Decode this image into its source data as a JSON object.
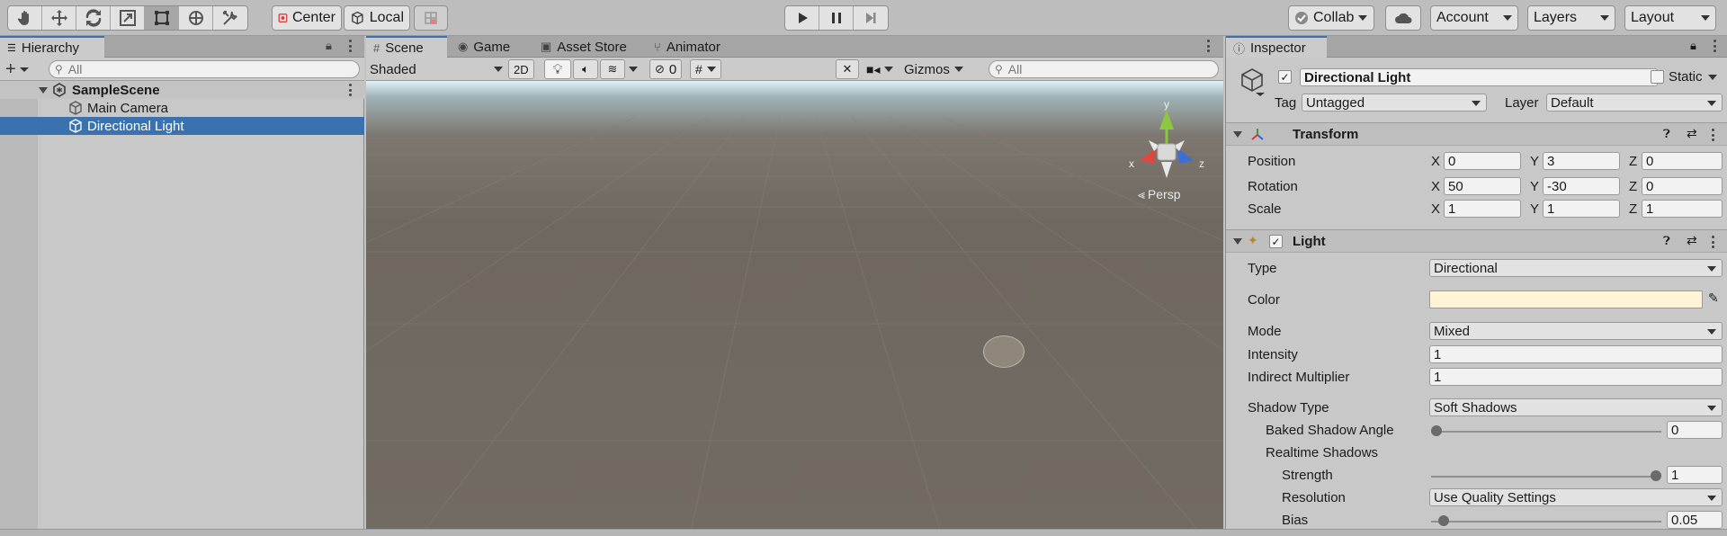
{
  "toolbar": {
    "tools": [
      "hand-tool",
      "move-tool",
      "rotate-tool",
      "scale-tool",
      "rect-tool",
      "transform-tool",
      "custom-tool"
    ],
    "pivot_label": "Center",
    "space_label": "Local",
    "collab_label": "Collab",
    "account_label": "Account",
    "layers_label": "Layers",
    "layout_label": "Layout"
  },
  "hierarchy": {
    "tab_label": "Hierarchy",
    "search_placeholder": "All",
    "scene_name": "SampleScene",
    "items": [
      {
        "label": "Main Camera",
        "selected": false
      },
      {
        "label": "Directional Light",
        "selected": true
      }
    ]
  },
  "scene_tabs": [
    {
      "label": "Scene",
      "icon": "grid-icon",
      "active": true
    },
    {
      "label": "Game",
      "icon": "gamepad-icon",
      "active": false
    },
    {
      "label": "Asset Store",
      "icon": "bag-icon",
      "active": false
    },
    {
      "label": "Animator",
      "icon": "animator-icon",
      "active": false
    }
  ],
  "scene_toolbar": {
    "shading_mode": "Shaded",
    "mode_2d": "2D",
    "hidden_count": "0",
    "gizmos_label": "Gizmos",
    "search_placeholder": "All"
  },
  "viewport": {
    "projection_label": "Persp",
    "axis_x": "x",
    "axis_y": "y",
    "axis_z": "z"
  },
  "inspector": {
    "tab_label": "Inspector",
    "object_name": "Directional Light",
    "static_label": "Static",
    "tag_label": "Tag",
    "tag_value": "Untagged",
    "layer_label": "Layer",
    "layer_value": "Default",
    "transform": {
      "title": "Transform",
      "position_label": "Position",
      "rotation_label": "Rotation",
      "scale_label": "Scale",
      "position": {
        "x": "0",
        "y": "3",
        "z": "0"
      },
      "rotation": {
        "x": "50",
        "y": "-30",
        "z": "0"
      },
      "scale": {
        "x": "1",
        "y": "1",
        "z": "1"
      },
      "x_letter": "X",
      "y_letter": "Y",
      "z_letter": "Z"
    },
    "light": {
      "title": "Light",
      "type_label": "Type",
      "type_value": "Directional",
      "color_label": "Color",
      "color_value": "#fff4d6",
      "mode_label": "Mode",
      "mode_value": "Mixed",
      "intensity_label": "Intensity",
      "intensity_value": "1",
      "indirect_label": "Indirect Multiplier",
      "indirect_value": "1",
      "shadow_type_label": "Shadow Type",
      "shadow_type_value": "Soft Shadows",
      "baked_angle_label": "Baked Shadow Angle",
      "baked_angle_value": "0",
      "realtime_label": "Realtime Shadows",
      "strength_label": "Strength",
      "strength_value": "1",
      "resolution_label": "Resolution",
      "resolution_value": "Use Quality Settings",
      "bias_label": "Bias",
      "bias_value": "0.05"
    }
  },
  "colors": {
    "selection": "#3a72b0",
    "accent_red": "#e0473c",
    "axis_green": "#8dc63f",
    "axis_blue": "#3b6fd6"
  }
}
